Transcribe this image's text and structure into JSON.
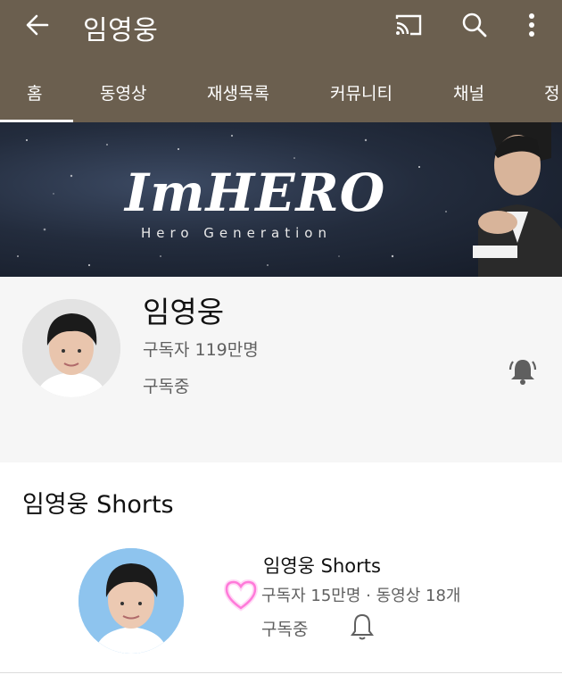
{
  "header": {
    "title": "임영웅",
    "icons": [
      "back-arrow-icon",
      "cast-icon",
      "search-icon",
      "more-vert-icon"
    ],
    "background": "#6b5f4f"
  },
  "tabs": [
    {
      "label": "홈",
      "selected": true
    },
    {
      "label": "동영상",
      "selected": false
    },
    {
      "label": "재생목록",
      "selected": false
    },
    {
      "label": "커뮤니티",
      "selected": false
    },
    {
      "label": "채널",
      "selected": false
    },
    {
      "label": "정",
      "selected": false
    }
  ],
  "banner": {
    "logo": "ImHERO",
    "subtitle": "Hero Generation"
  },
  "channel": {
    "name": "임영웅",
    "subscribers": "구독자 119만명",
    "status": "구독중",
    "bell": "bell-filled-icon"
  },
  "shorts": {
    "heading": "임영웅 Shorts",
    "name": "임영웅 Shorts",
    "stats": "구독자 15만명 · 동영상 18개",
    "status": "구독중",
    "bell": "bell-outline-icon",
    "heart_icon": "heart-icon",
    "heart_color": "#ff7ad9",
    "avatar_bg": "#8ec4ee"
  }
}
